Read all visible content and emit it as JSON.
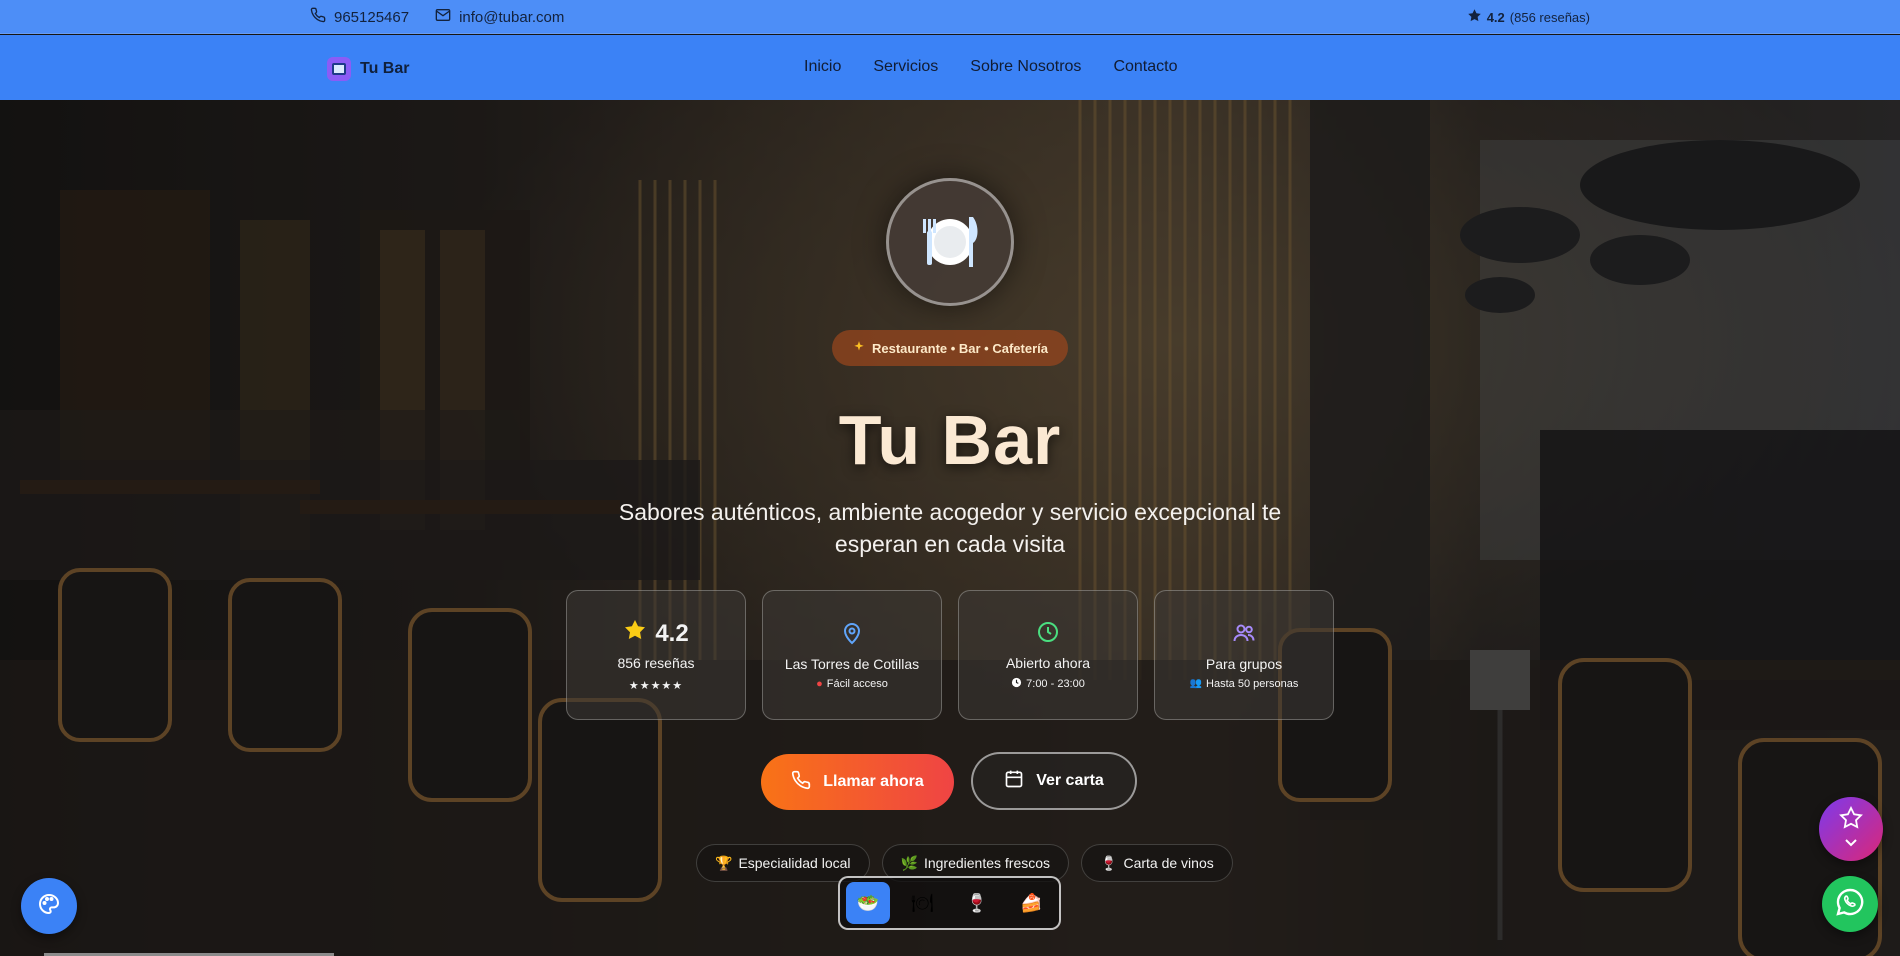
{
  "topbar": {
    "phone": "965125467",
    "email": "info@tubar.com",
    "rating_value": "4.2",
    "rating_reviews": "(856 reseñas)",
    "phone_icon": "phone-icon",
    "email_icon": "mail-icon",
    "star_icon": "star-icon"
  },
  "navbar": {
    "brand": "Tu Bar",
    "links": [
      "Inicio",
      "Servicios",
      "Sobre Nosotros",
      "Contacto"
    ]
  },
  "hero": {
    "tag": "Restaurante • Bar • Cafetería",
    "title": "Tu Bar",
    "subtitle": "Sabores auténticos, ambiente acogedor y servicio excepcional te esperan en cada visita",
    "stats": [
      {
        "big": "4.2",
        "line1": "856 reseñas",
        "line2": "★★★★★",
        "icon": "star-icon"
      },
      {
        "line1": "Las Torres de Cotillas",
        "line2": "Fácil acceso",
        "icon": "map-pin-icon"
      },
      {
        "line1": "Abierto ahora",
        "line2": "7:00 - 23:00",
        "icon": "clock-icon"
      },
      {
        "line1": "Para grupos",
        "line2": "Hasta 50 personas",
        "icon": "users-icon"
      }
    ],
    "call_button": "Llamar ahora",
    "menu_button": "Ver carta",
    "chips": [
      "Especialidad local",
      "Ingredientes frescos",
      "Carta de vinos"
    ],
    "switcher": [
      "salad-icon",
      "plate-icon",
      "wine-icon",
      "cake-icon"
    ]
  },
  "colors": {
    "topbar": "#4d8ef7",
    "navbar": "#3b82f6",
    "accent_orange": "#f97316",
    "whatsapp": "#22c55e",
    "fav_gradient_start": "#7c3aed",
    "fav_gradient_end": "#db2777"
  }
}
